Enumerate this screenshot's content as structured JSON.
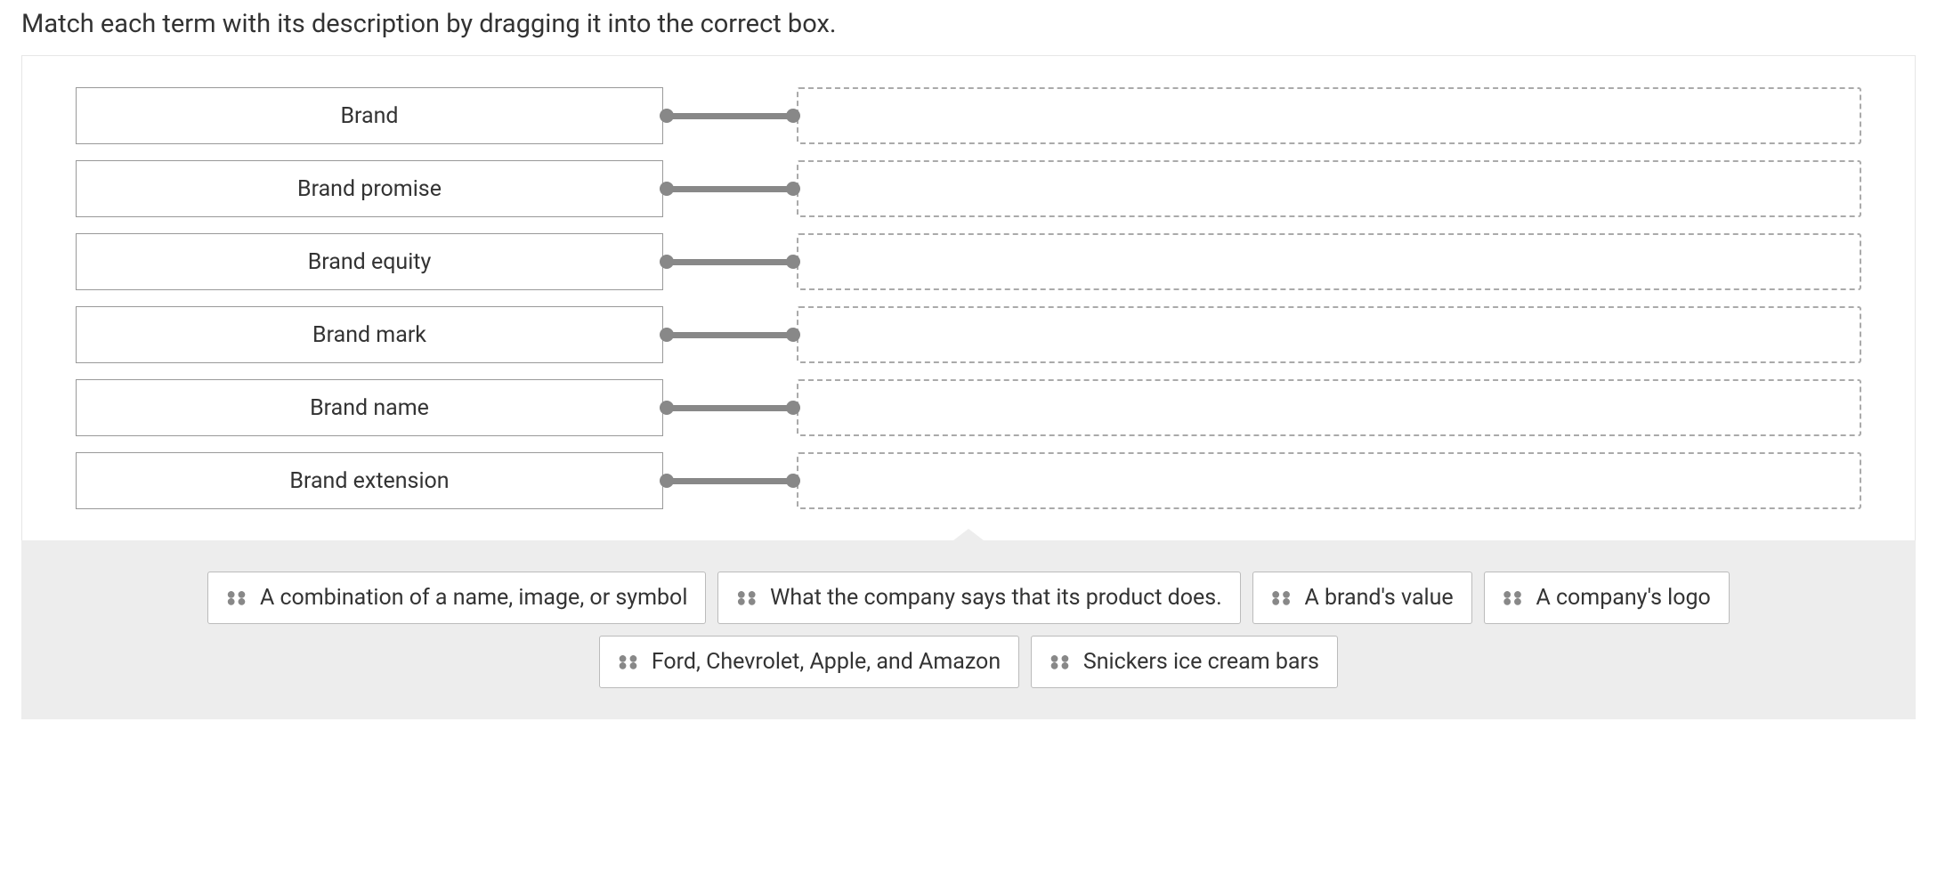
{
  "instructions": "Match each term with its description by dragging it into the correct box.",
  "terms": [
    {
      "label": "Brand"
    },
    {
      "label": "Brand promise"
    },
    {
      "label": "Brand equity"
    },
    {
      "label": "Brand mark"
    },
    {
      "label": "Brand name"
    },
    {
      "label": "Brand extension"
    }
  ],
  "options": [
    {
      "label": "A combination of a name, image, or symbol"
    },
    {
      "label": "What the company says that its product does."
    },
    {
      "label": "A brand's value"
    },
    {
      "label": "A company's logo"
    },
    {
      "label": "Ford, Chevrolet, Apple, and Amazon"
    },
    {
      "label": "Snickers ice cream bars"
    }
  ]
}
